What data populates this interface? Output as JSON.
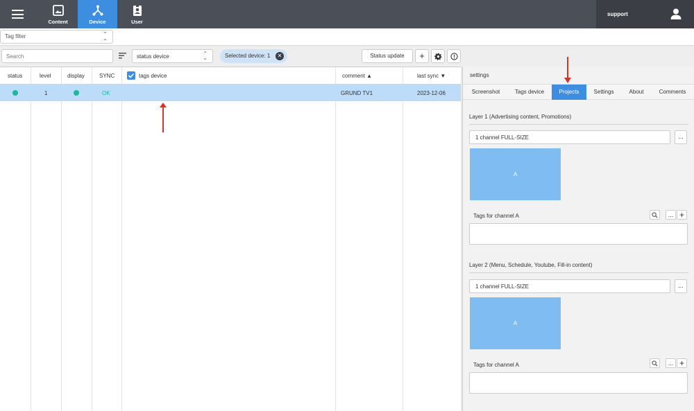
{
  "nav": {
    "tabs": [
      {
        "label": "Content",
        "icon": "image-icon"
      },
      {
        "label": "Device",
        "icon": "network-icon"
      },
      {
        "label": "User",
        "icon": "id-badge-icon"
      }
    ],
    "user": {
      "name": "support",
      "icon": "person-icon"
    }
  },
  "filters": {
    "tag_filter": "Tag filter",
    "search_placeholder": "Search",
    "status_select": "status device",
    "selected_chip": "Selected device: 1",
    "status_update": "Status update",
    "add": "+",
    "more": "..."
  },
  "table": {
    "headers": {
      "status": "status",
      "level": "level",
      "display": "display",
      "sync": "SYNC",
      "tags": "tags device",
      "comment": "comment ▲",
      "last_sync": "last sync ▼"
    },
    "rows": [
      {
        "status_color": "#1fb89a",
        "level": "1",
        "display_color": "#1fb89a",
        "sync": "OK",
        "tags": "",
        "comment": "GRUND TV1",
        "last_sync": "2023-12-06"
      }
    ]
  },
  "panel": {
    "title": "settings",
    "tabs": [
      "Screenshot",
      "Tags device",
      "Projects",
      "Settings",
      "About",
      "Comments"
    ],
    "active_tab": "Projects",
    "layers": [
      {
        "title": "Layer 1 (Advertising content, Promotions)",
        "mode": "1 channel FULL-SIZE",
        "channel": "A",
        "tags_label": "Tags for channel A"
      },
      {
        "title": "Layer 2 (Menu, Schedule, Youtube, Fill-in content)",
        "mode": "1 channel FULL-SIZE",
        "channel": "A",
        "tags_label": "Tags for channel A"
      }
    ]
  },
  "colors": {
    "topbar": "#4a4f58",
    "accent": "#3d8ee0",
    "selected_row": "#bcdcf9",
    "channel_fill": "#7fbcf2",
    "status_ok": "#1fb89a",
    "annotation_arrow": "#d0362b"
  }
}
